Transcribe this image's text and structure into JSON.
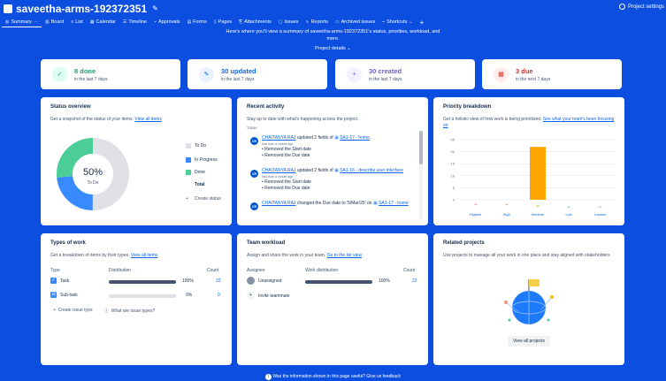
{
  "header": {
    "project_title": "saveetha-arms-192372351",
    "settings_label": "Project settings"
  },
  "tabs": [
    {
      "label": "Summary",
      "icon": "globe-icon"
    },
    {
      "label": "Board",
      "icon": "board-icon"
    },
    {
      "label": "List",
      "icon": "list-icon"
    },
    {
      "label": "Calendar",
      "icon": "calendar-icon"
    },
    {
      "label": "Timeline",
      "icon": "timeline-icon"
    },
    {
      "label": "Approvals",
      "icon": "approvals-icon"
    },
    {
      "label": "Forms",
      "icon": "forms-icon"
    },
    {
      "label": "Pages",
      "icon": "pages-icon"
    },
    {
      "label": "Attachments",
      "icon": "attachment-icon"
    },
    {
      "label": "Issues",
      "icon": "issues-icon"
    },
    {
      "label": "Reports",
      "icon": "reports-icon"
    },
    {
      "label": "Archived issues",
      "icon": "archive-icon"
    },
    {
      "label": "Shortcuts",
      "icon": "shortcuts-icon"
    }
  ],
  "intro": {
    "line1": "Here's where you'll view a summary of saveetha-arms-192372351's status, priorities, workload, and",
    "line2": "more.",
    "details_label": "Project details"
  },
  "stats": [
    {
      "num": "8 done",
      "sub": "in the last 7 days",
      "color": "#22a06b",
      "bg": "#dcfff1",
      "glyph": "✓"
    },
    {
      "num": "30 updated",
      "sub": "in the last 7 days",
      "color": "#0c66e4",
      "bg": "#e9f2ff",
      "glyph": "✎"
    },
    {
      "num": "30 created",
      "sub": "in the last 7 days",
      "color": "#6e5dc6",
      "bg": "#f3f0ff",
      "glyph": "+"
    },
    {
      "num": "3 due",
      "sub": "in the next 7 days",
      "color": "#c9372c",
      "bg": "#ffeceb",
      "glyph": "▦"
    }
  ],
  "status_overview": {
    "title": "Status overview",
    "desc": "Get a snapshot of the status of your items.",
    "link": "View all items",
    "center_pct": "50%",
    "center_label": "To Do",
    "legend": [
      {
        "label": "To Do",
        "count": "15",
        "value": 15,
        "color": "#dfe1e6"
      },
      {
        "label": "In Progress",
        "count": "7",
        "value": 7,
        "color": "#388bff"
      },
      {
        "label": "Done",
        "count": "8",
        "value": 8,
        "color": "#4bce97"
      }
    ],
    "total_label": "Total",
    "total": "30",
    "create_label": "Create status"
  },
  "recent_activity": {
    "title": "Recent activity",
    "desc": "Stay up to date with what's happening across the project.",
    "day_label": "TODAY",
    "items": [
      {
        "user": "CHAITANYA RAJ",
        "action": "updated 2 fields of",
        "issue": "SA1-17 - home",
        "time": "less than a minute ago",
        "bullets": [
          "Removed the Start date",
          "Removed the Due date"
        ]
      },
      {
        "user": "CHAITANYA RAJ",
        "action": "updated 2 fields of",
        "issue": "SA1-16 - describe user interface",
        "time": "less than a minute ago",
        "bullets": [
          "Removed the Start date",
          "Removed the Due date"
        ]
      },
      {
        "user": "CHAITANYA RAJ",
        "action": "changed the Due date to '5/Mar/25' on",
        "issue": "SA1-17 - home",
        "time": "",
        "bullets": []
      }
    ],
    "avatar": "CR"
  },
  "priority": {
    "title": "Priority breakdown",
    "desc": "Get a holistic view of how work is being prioritized.",
    "link": "See what your team's been focusing on"
  },
  "chart_data": {
    "type": "bar",
    "categories": [
      "Highest",
      "High",
      "Medium",
      "Low",
      "Lowest"
    ],
    "values": [
      0,
      0,
      22,
      0,
      0
    ],
    "ylim": [
      0,
      25
    ],
    "yticks": [
      0,
      5,
      10,
      15,
      20,
      25
    ],
    "bar_color": "#ffa500",
    "icon_colors": [
      "#e2483d",
      "#e2483d",
      "#e2b203",
      "#388bff",
      "#388bff"
    ],
    "grid": true
  },
  "types_of_work": {
    "title": "Types of work",
    "desc": "Get a breakdown of items by their types.",
    "link": "View all items",
    "col_type": "Type",
    "col_dist": "Distribution",
    "col_count": "Count",
    "rows": [
      {
        "label": "Task",
        "pct": "100%",
        "fill": 1.0,
        "count": "22"
      },
      {
        "label": "Sub-task",
        "pct": "0%",
        "fill": 0.0,
        "count": "0"
      }
    ],
    "create_label": "Create issue type",
    "what_label": "What are issue types?"
  },
  "team_workload": {
    "title": "Team workload",
    "desc": "Assign and share the work in your team.",
    "link": "Go to the list view",
    "col_assignee": "Assignee",
    "col_dist": "Work distribution",
    "col_count": "Count",
    "rows": [
      {
        "label": "Unassigned",
        "pct": "100%",
        "fill": 1.0,
        "count": "22"
      }
    ],
    "invite_label": "Invite teammate"
  },
  "related": {
    "title": "Related projects",
    "desc": "Use projects to manage all your work in one place and stay aligned with stakeholders.",
    "button_label": "View all projects"
  },
  "footer": {
    "text": "Was the information shown in this page useful? Give us feedback"
  }
}
